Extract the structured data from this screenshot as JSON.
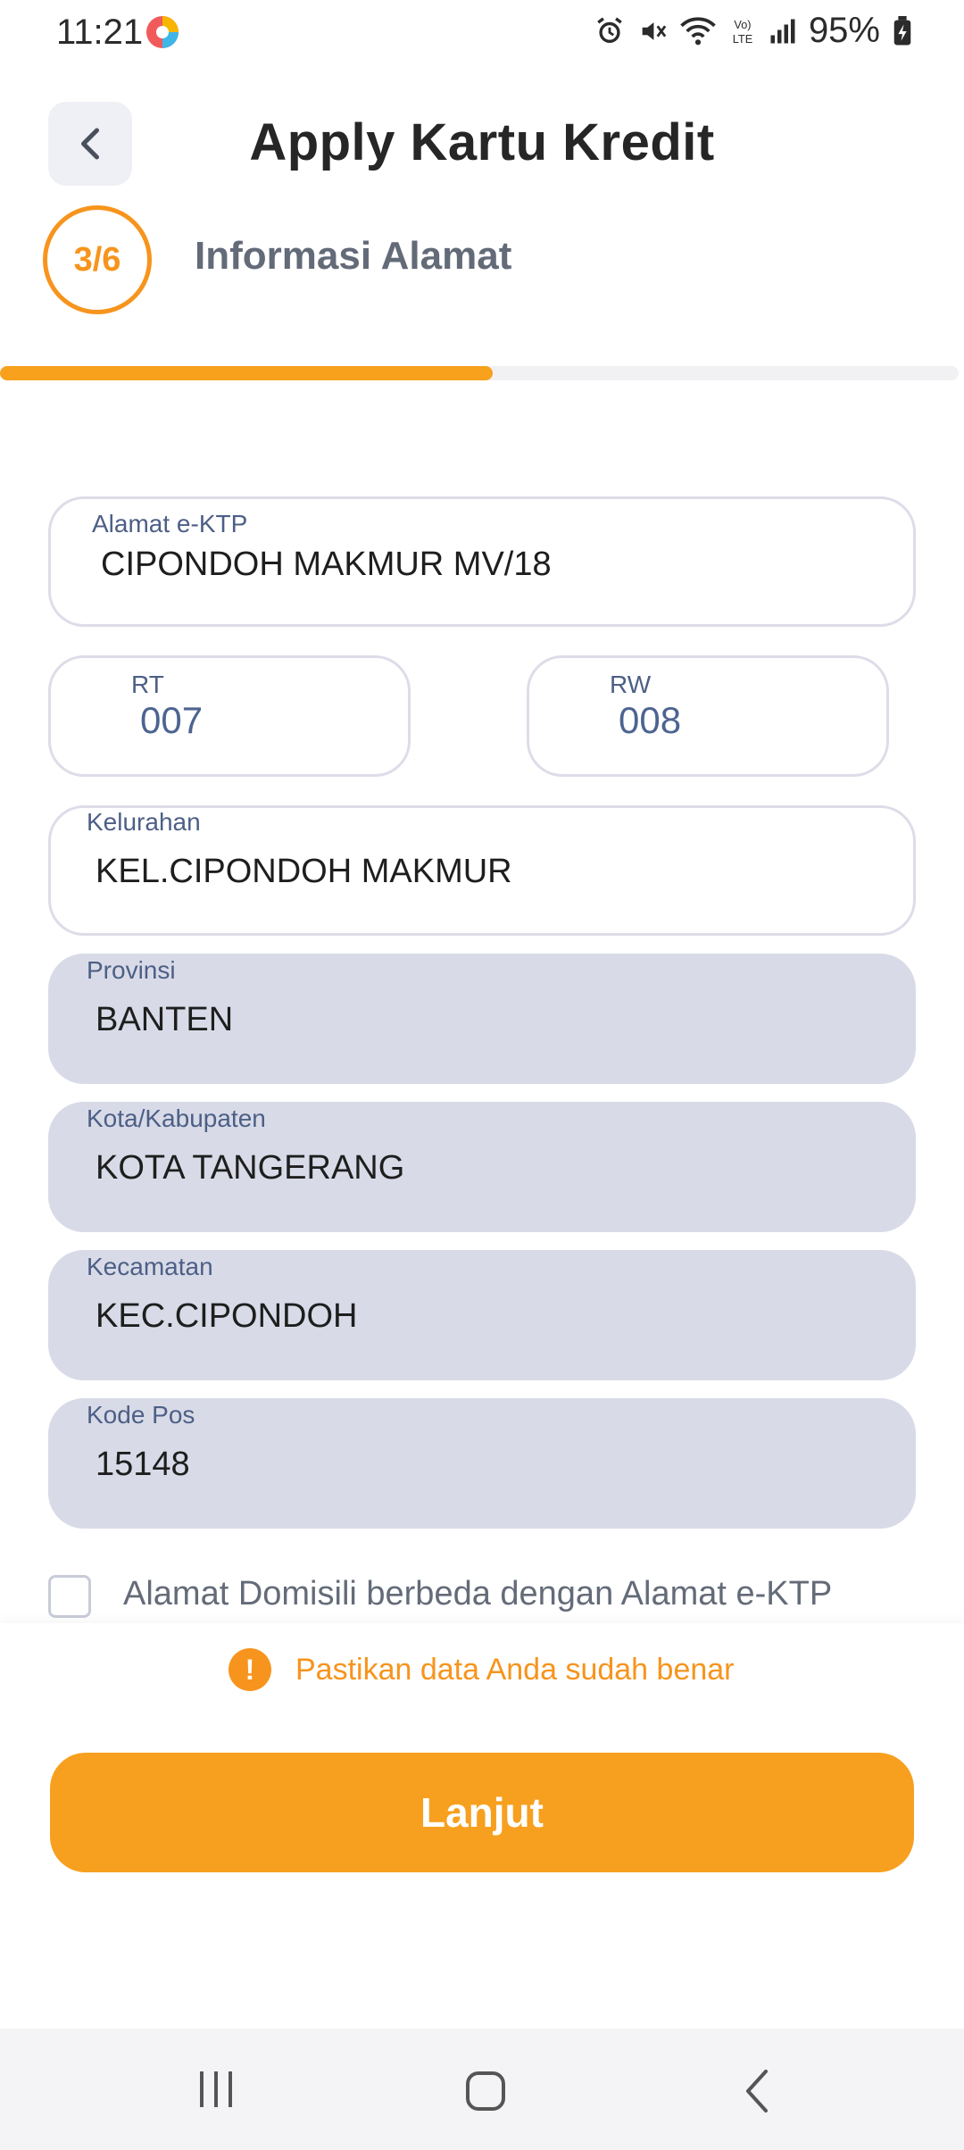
{
  "status_bar": {
    "time": "11:21",
    "battery": "95%"
  },
  "header": {
    "title": "Apply Kartu Kredit"
  },
  "step": {
    "indicator": "3/6",
    "title": "Informasi Alamat",
    "progress_fraction": 0.5
  },
  "form": {
    "alamat": {
      "label": "Alamat e-KTP",
      "value": "CIPONDOH MAKMUR MV/18"
    },
    "rt": {
      "label": "RT",
      "value": "007"
    },
    "rw": {
      "label": "RW",
      "value": "008"
    },
    "kelurahan": {
      "label": "Kelurahan",
      "value": "KEL.CIPONDOH MAKMUR"
    },
    "provinsi": {
      "label": "Provinsi",
      "value": "BANTEN"
    },
    "kota": {
      "label": "Kota/Kabupaten",
      "value": "KOTA TANGERANG"
    },
    "kecamatan": {
      "label": "Kecamatan",
      "value": "KEC.CIPONDOH"
    },
    "kodepos": {
      "label": "Kode Pos",
      "value": "15148"
    },
    "domisili_checkbox": {
      "label": "Alamat Domisili berbeda dengan Alamat e-KTP",
      "checked": false
    }
  },
  "notice": {
    "icon": "!",
    "text": "Pastikan data Anda sudah benar"
  },
  "cta": {
    "label": "Lanjut"
  },
  "colors": {
    "accent": "#f7941d",
    "button": "#f7a01f",
    "disabled_field": "#d8dbe7"
  }
}
